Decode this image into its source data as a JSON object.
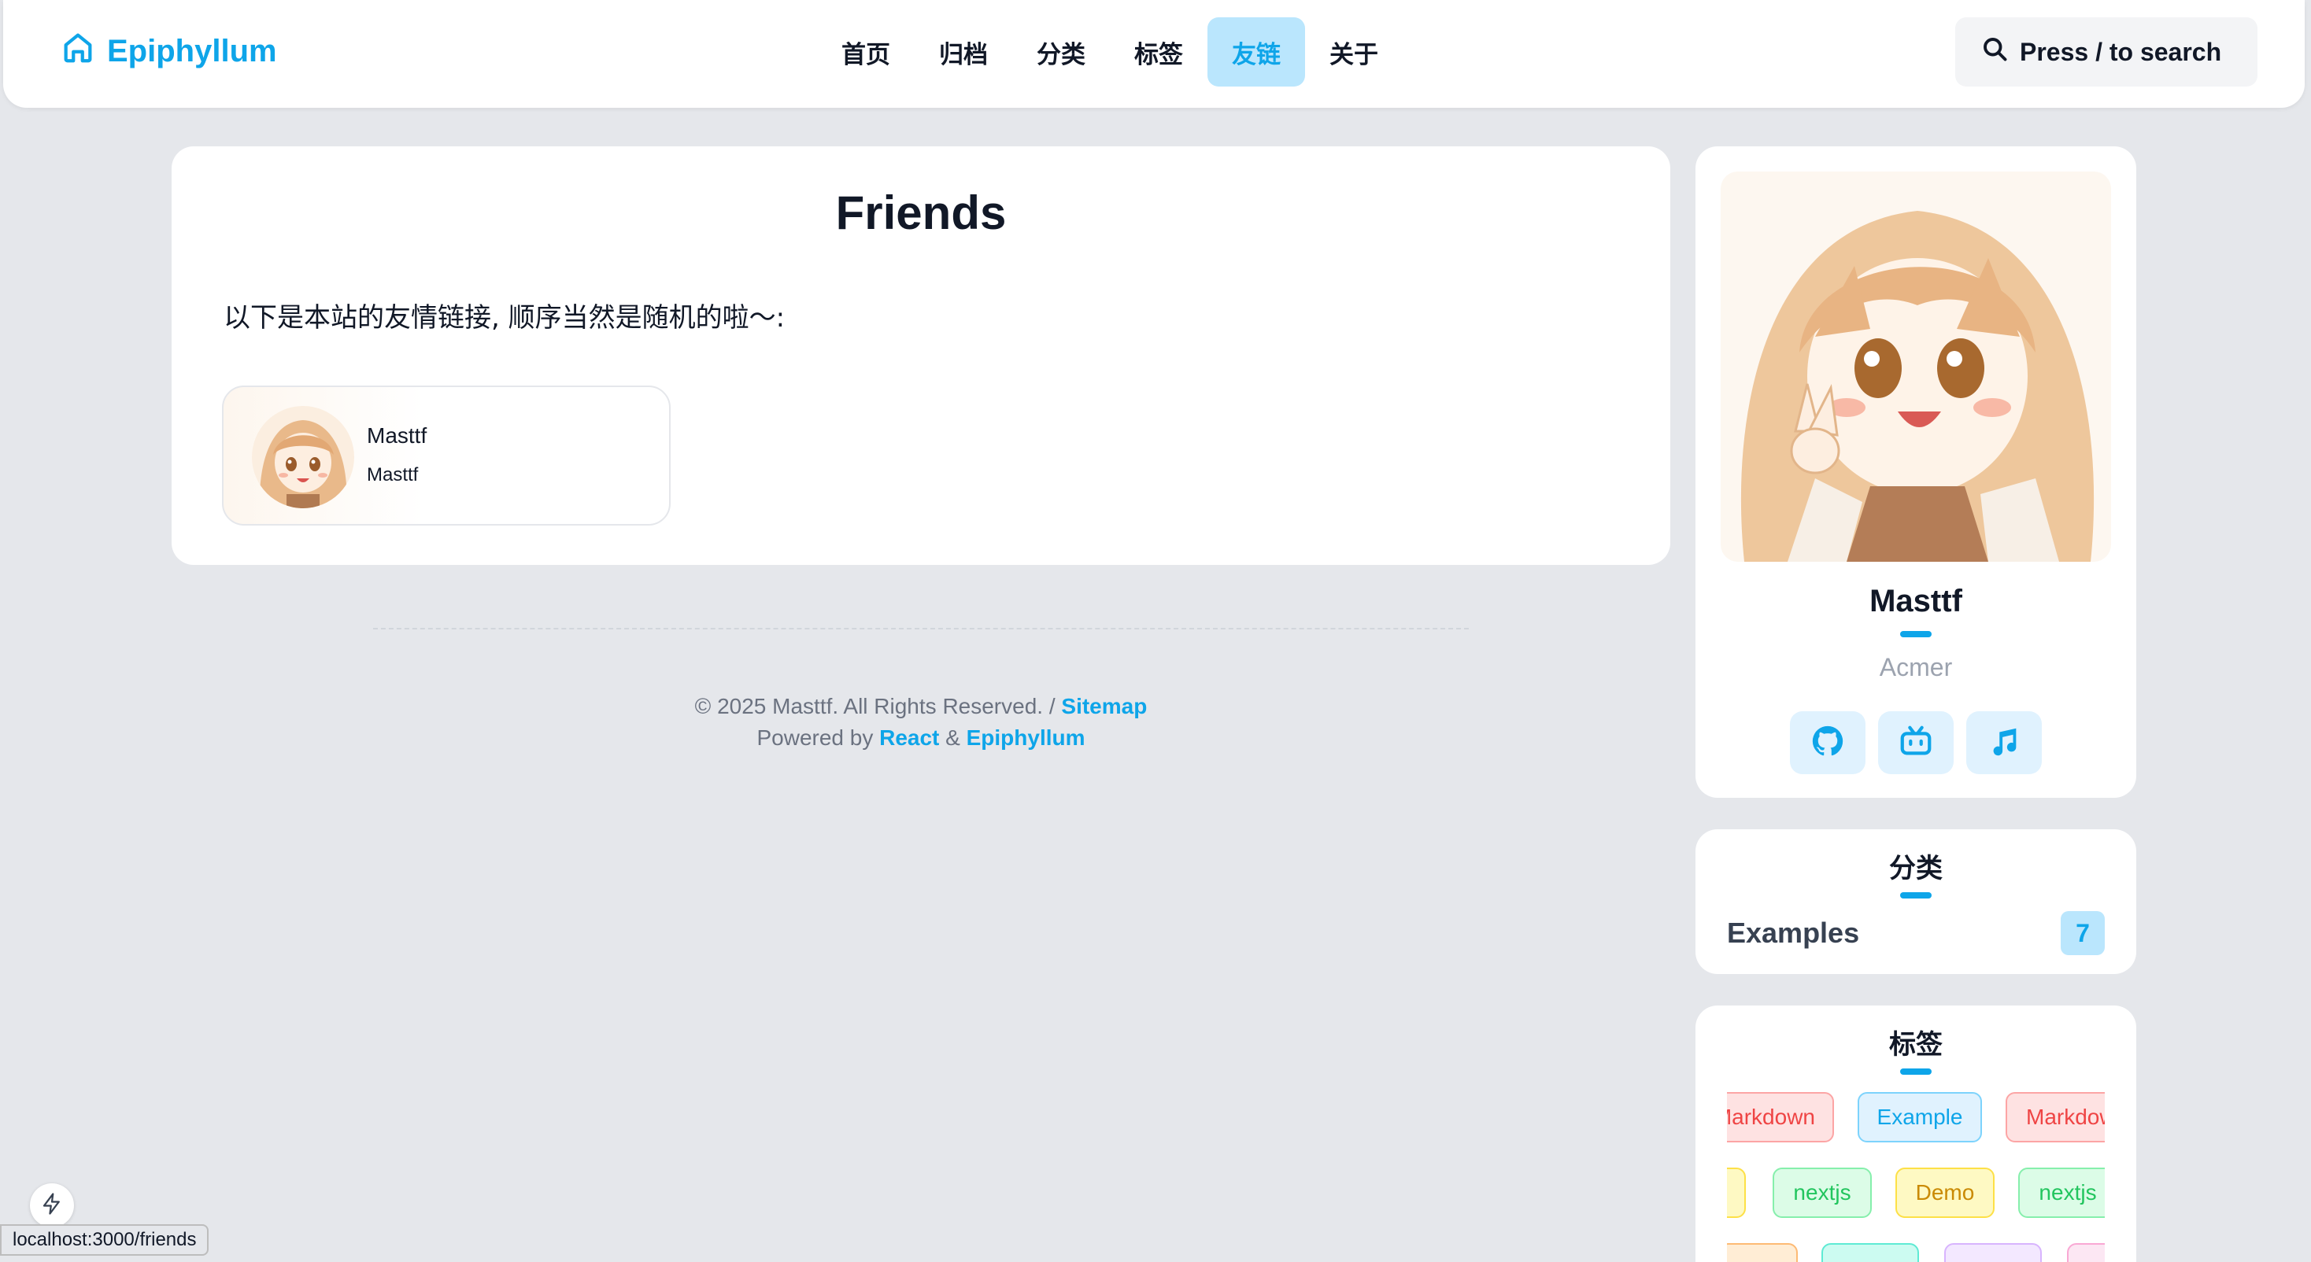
{
  "header": {
    "brand_name": "Epiphyllum",
    "brand_icon": "home-icon",
    "nav": [
      {
        "label": "首页"
      },
      {
        "label": "归档"
      },
      {
        "label": "分类"
      },
      {
        "label": "标签"
      },
      {
        "label": "友链",
        "active": true
      },
      {
        "label": "关于"
      }
    ],
    "search_label": "Press / to search",
    "accent_color": "#0ea5e9"
  },
  "main": {
    "title": "Friends",
    "intro": "以下是本站的友情链接, 顺序当然是随机的啦～:",
    "friends": [
      {
        "name": "Masttf",
        "description": "Masttf"
      }
    ]
  },
  "footer": {
    "copyright": "© 2025 Masttf. All Rights Reserved. / ",
    "sitemap_link": "Sitemap",
    "powered_prefix": "Powered by ",
    "react_link": "React",
    "and_text": " & ",
    "epiphyllum_link": "Epiphyllum"
  },
  "sidebar": {
    "profile": {
      "name": "Masttf",
      "role": "Acmer",
      "social": [
        {
          "icon": "github-icon"
        },
        {
          "icon": "bilibili-icon"
        },
        {
          "icon": "music-icon"
        }
      ]
    },
    "categories": {
      "title": "分类",
      "items": [
        {
          "name": "Examples",
          "count": "7"
        }
      ]
    },
    "tags": {
      "title": "标签",
      "items": [
        {
          "label": "Markdown",
          "color": "red"
        },
        {
          "label": "Example",
          "color": "blue"
        },
        {
          "label": "Markdown",
          "color": "red"
        },
        {
          "label": "Demo",
          "color": "yellow"
        },
        {
          "label": "nextjs",
          "color": "green"
        },
        {
          "label": "Demo",
          "color": "yellow"
        },
        {
          "label": "nextjs",
          "color": "green"
        }
      ]
    }
  },
  "status_bar": {
    "url": "localhost:3000/friends"
  }
}
